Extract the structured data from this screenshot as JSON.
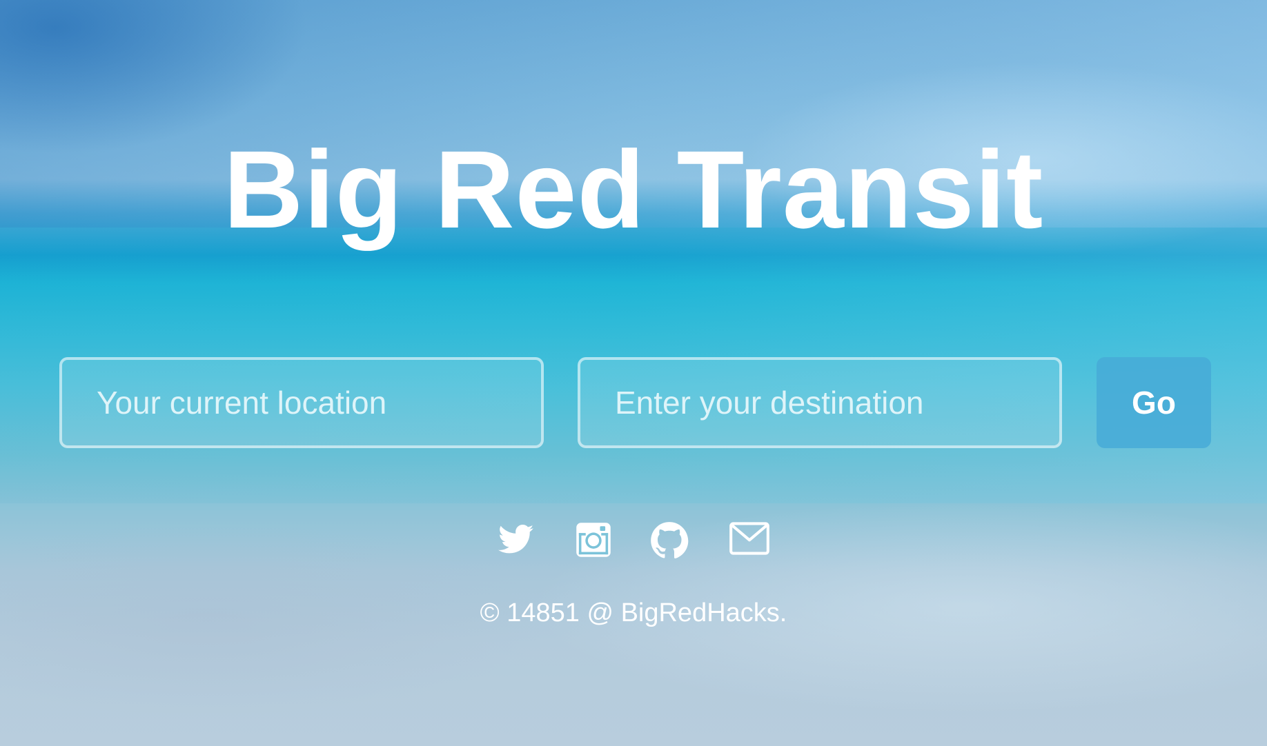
{
  "hero": {
    "title": "Big Red Transit"
  },
  "search": {
    "origin_placeholder": "Your current location",
    "destination_placeholder": "Enter your destination",
    "go_label": "Go"
  },
  "social": {
    "icons": [
      "twitter-icon",
      "instagram-icon",
      "github-icon",
      "mail-icon"
    ]
  },
  "footer": {
    "copyright": "© 14851 @ BigRedHacks."
  },
  "colors": {
    "text": "#ffffff",
    "go_button": "#46aad7"
  }
}
